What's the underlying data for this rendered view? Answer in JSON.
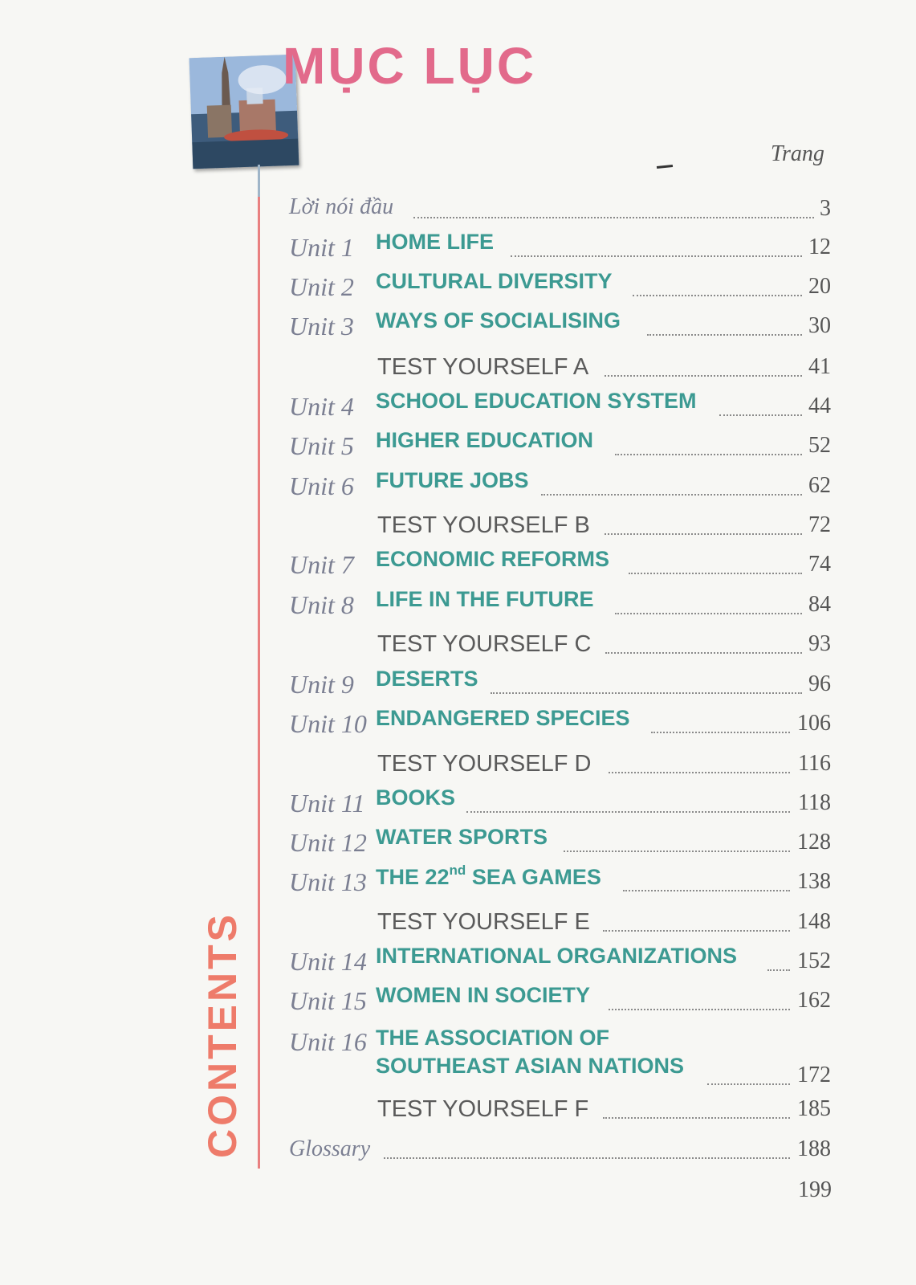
{
  "header": {
    "title": "MỤC LỤC",
    "page_column_label": "Trang",
    "side_label": "CONTENTS"
  },
  "entries": [
    {
      "unit": "Lời nói đầu",
      "name": "",
      "page": "3",
      "kind": "preface"
    },
    {
      "unit": "Unit 1",
      "name": "HOME LIFE",
      "page": "12",
      "kind": "unit"
    },
    {
      "unit": "Unit 2",
      "name": "CULTURAL DIVERSITY",
      "page": "20",
      "kind": "unit"
    },
    {
      "unit": "Unit 3",
      "name": "WAYS OF SOCIALISING",
      "page": "30",
      "kind": "unit"
    },
    {
      "unit": "",
      "name": "TEST YOURSELF A",
      "page": "41",
      "kind": "test"
    },
    {
      "unit": "Unit 4",
      "name": "SCHOOL EDUCATION SYSTEM",
      "page": "44",
      "kind": "unit"
    },
    {
      "unit": "Unit 5",
      "name": "HIGHER EDUCATION",
      "page": "52",
      "kind": "unit"
    },
    {
      "unit": "Unit 6",
      "name": "FUTURE JOBS",
      "page": "62",
      "kind": "unit"
    },
    {
      "unit": "",
      "name": "TEST YOURSELF B",
      "page": "72",
      "kind": "test"
    },
    {
      "unit": "Unit 7",
      "name": "ECONOMIC REFORMS",
      "page": "74",
      "kind": "unit"
    },
    {
      "unit": "Unit 8",
      "name": "LIFE IN THE FUTURE",
      "page": "84",
      "kind": "unit"
    },
    {
      "unit": "",
      "name": "TEST YOURSELF C",
      "page": "93",
      "kind": "test"
    },
    {
      "unit": "Unit 9",
      "name": "DESERTS",
      "page": "96",
      "kind": "unit"
    },
    {
      "unit": "Unit 10",
      "name": "ENDANGERED SPECIES",
      "page": "106",
      "kind": "unit"
    },
    {
      "unit": "",
      "name": "TEST YOURSELF D",
      "page": "116",
      "kind": "test"
    },
    {
      "unit": "Unit 11",
      "name": "BOOKS",
      "page": "118",
      "kind": "unit"
    },
    {
      "unit": "Unit 12",
      "name": "WATER SPORTS",
      "page": "128",
      "kind": "unit"
    },
    {
      "unit": "Unit 13",
      "name": "THE 22",
      "name_sup": "nd",
      "name_rest": " SEA GAMES",
      "page": "138",
      "kind": "unit"
    },
    {
      "unit": "",
      "name": "TEST YOURSELF E",
      "page": "148",
      "kind": "test"
    },
    {
      "unit": "Unit 14",
      "name": "INTERNATIONAL ORGANIZATIONS",
      "page": "152",
      "kind": "unit"
    },
    {
      "unit": "Unit 15",
      "name": "WOMEN IN SOCIETY",
      "page": "162",
      "kind": "unit"
    },
    {
      "unit": "Unit 16",
      "name": "THE ASSOCIATION OF",
      "name_line2": "SOUTHEAST ASIAN NATIONS",
      "page": "172",
      "kind": "unit"
    },
    {
      "unit": "",
      "name": "TEST YOURSELF F",
      "page": "185",
      "kind": "test"
    },
    {
      "unit": "Glossary",
      "name": "",
      "page": "188",
      "kind": "glossary"
    }
  ],
  "footer": {
    "page_number": "199"
  },
  "colors": {
    "title": "#e26a8b",
    "unit_name": "#3c9a92",
    "side_label": "#ee7b6a",
    "rule": "#e98080"
  }
}
